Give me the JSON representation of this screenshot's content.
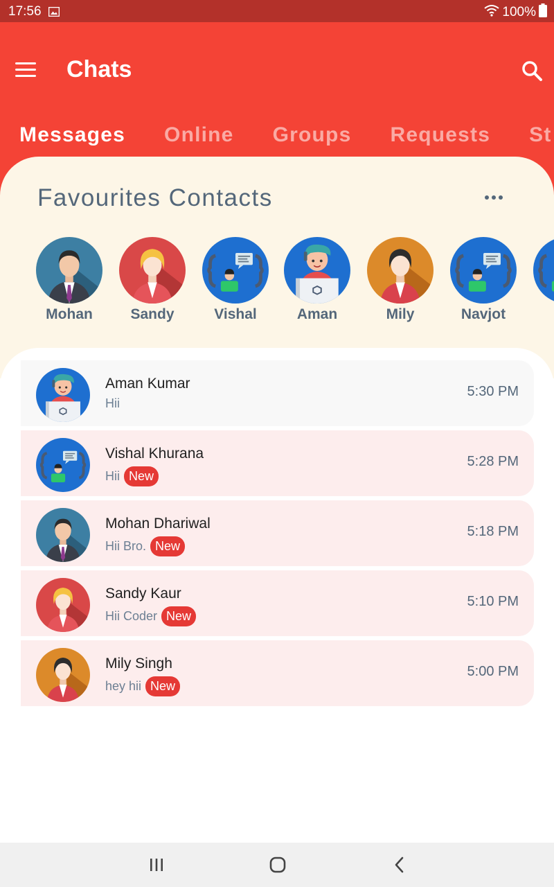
{
  "status_bar": {
    "time": "17:56",
    "battery": "100%",
    "background_color": "#b3312a",
    "icons": [
      "image-notification-icon",
      "wifi-icon",
      "battery-icon"
    ]
  },
  "header": {
    "title": "Chats",
    "background_color": "#f44336",
    "menu_icon": "hamburger-menu-icon",
    "search_icon": "search-icon"
  },
  "tabs": [
    {
      "label": "Messages",
      "active": true
    },
    {
      "label": "Online",
      "active": false
    },
    {
      "label": "Groups",
      "active": false
    },
    {
      "label": "Requests",
      "active": false
    },
    {
      "label": "St",
      "active": false
    }
  ],
  "favourites": {
    "title": "Favourites Contacts",
    "more_icon": "more-horizontal-icon",
    "background_color": "#fdf6e7",
    "contacts": [
      {
        "name": "Mohan",
        "avatar": "man-suit-avatar"
      },
      {
        "name": "Sandy",
        "avatar": "woman-blonde-avatar"
      },
      {
        "name": "Vishal",
        "avatar": "developer-chat-avatar"
      },
      {
        "name": "Aman",
        "avatar": "laptop-user-avatar"
      },
      {
        "name": "Mily",
        "avatar": "woman-dark-hair-avatar"
      },
      {
        "name": "Navjot",
        "avatar": "developer-chat-avatar"
      }
    ]
  },
  "chats": [
    {
      "name": "Aman Kumar",
      "message": "Hii",
      "time": "5:30 PM",
      "is_new": false,
      "badge": "",
      "avatar": "laptop-user-avatar"
    },
    {
      "name": "Vishal Khurana",
      "message": "Hii",
      "time": "5:28 PM",
      "is_new": true,
      "badge": "New",
      "avatar": "developer-chat-avatar"
    },
    {
      "name": "Mohan Dhariwal",
      "message": "Hii Bro.",
      "time": "5:18 PM",
      "is_new": true,
      "badge": "New",
      "avatar": "man-suit-avatar"
    },
    {
      "name": "Sandy Kaur",
      "message": "Hii Coder",
      "time": "5:10 PM",
      "is_new": true,
      "badge": "New",
      "avatar": "woman-blonde-avatar"
    },
    {
      "name": "Mily Singh",
      "message": "hey hii",
      "time": "5:00 PM",
      "is_new": true,
      "badge": "New",
      "avatar": "woman-dark-hair-avatar"
    }
  ],
  "nav_bar": {
    "icons": [
      "recent-apps-icon",
      "home-icon",
      "back-icon"
    ]
  },
  "colors": {
    "accent": "#f44336",
    "badge": "#e53935",
    "text_secondary": "#54677a",
    "unread_row": "#fdeded",
    "read_row": "#f8f8f8"
  }
}
